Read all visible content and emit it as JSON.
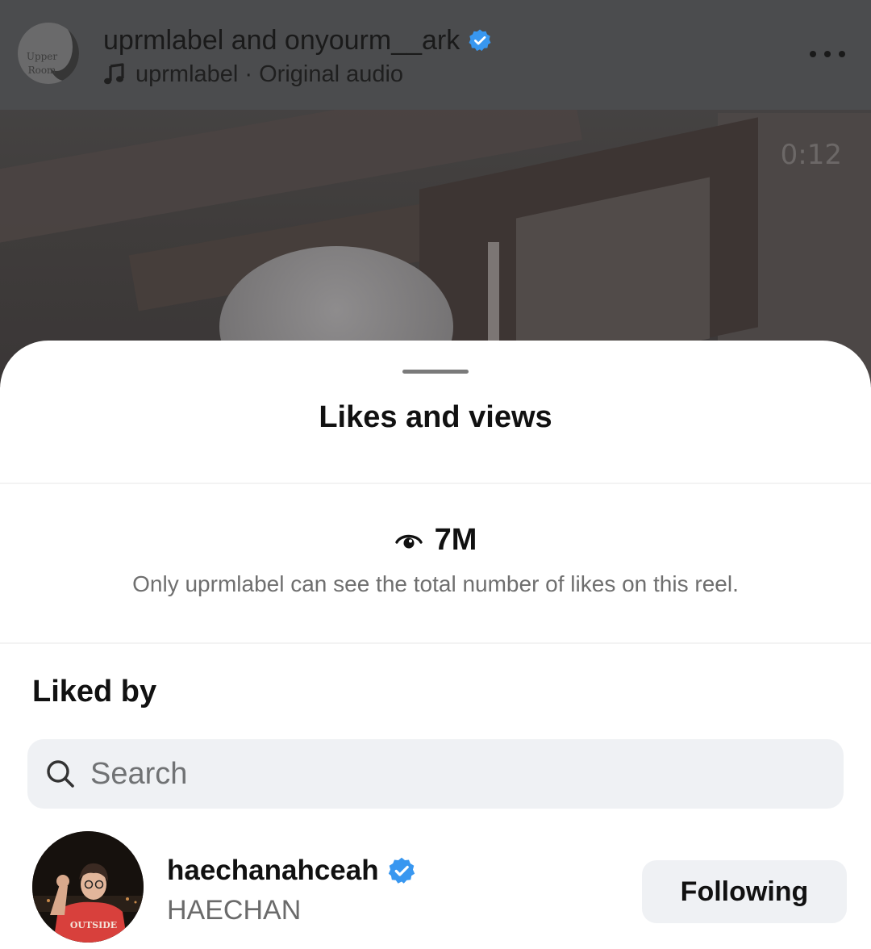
{
  "reel": {
    "header": {
      "avatar_text_line1": "Upper",
      "avatar_text_line2": "Room",
      "title": "uprmlabel and onyourm__ark",
      "audio_label": "uprmlabel · Original audio"
    },
    "timer": "0:12"
  },
  "sheet": {
    "title": "Likes and views",
    "views": {
      "count": "7M",
      "note": "Only uprmlabel can see the total number of likes on this reel."
    },
    "liked_by": {
      "heading": "Liked by",
      "search": {
        "placeholder": "Search",
        "value": ""
      },
      "users": [
        {
          "username": "haechanahceah",
          "full_name": "HAECHAN",
          "verified": true,
          "button_label": "Following",
          "shirt_text": "OUTSIDE"
        }
      ]
    }
  },
  "icons": {
    "verified": "verified-badge-icon",
    "music": "music-note-icon",
    "more": "more-options-icon",
    "eye": "eye-icon",
    "search": "search-icon"
  },
  "colors": {
    "verified_blue": "#3897f0",
    "sheet_background": "#ffffff",
    "search_background": "#eff1f4",
    "header_overlay": "#4b4c4e",
    "muted_text": "#6f6f6f"
  }
}
